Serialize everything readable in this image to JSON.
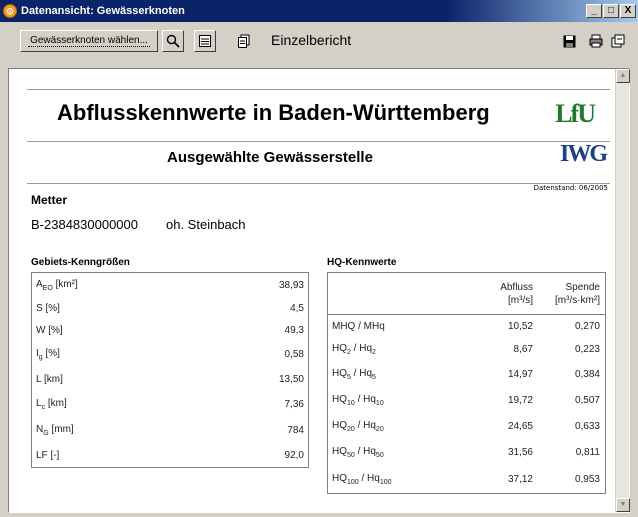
{
  "window": {
    "title": "Datenansicht: Gewässerknoten",
    "minimize": "_",
    "maximize": "□",
    "close": "X"
  },
  "toolbar": {
    "select_label": "Gewässerknoten wählen...",
    "report_label": "Einzelbericht"
  },
  "report": {
    "title": "Abflusskennwerte in Baden-Württemberg",
    "subtitle": "Ausgewählte Gewässerstelle",
    "logo1": "LfU",
    "logo2": "IWG",
    "datenstand": "Datenstand: 06/2005",
    "station_name": "Metter",
    "station_id": "B-2384830000000",
    "station_desc": "oh. Steinbach",
    "gebiet_label": "Gebiets-Kenngrößen",
    "hq_label": "HQ-Kennwerte",
    "gebiet_rows": [
      {
        "label": "A",
        "sub": "EO",
        "unit": " [km²]",
        "value": "38,93"
      },
      {
        "label": "S [%]",
        "sub": "",
        "unit": "",
        "value": "4,5"
      },
      {
        "label": "W [%]",
        "sub": "",
        "unit": "",
        "value": "49,3"
      },
      {
        "label": "I",
        "sub": "g",
        "unit": " [%]",
        "value": "0,58"
      },
      {
        "label": "L [km]",
        "sub": "",
        "unit": "",
        "value": "13,50"
      },
      {
        "label": "L",
        "sub": "c",
        "unit": " [km]",
        "value": "7,36"
      },
      {
        "label": "N",
        "sub": "G",
        "unit": " [mm]",
        "value": "784"
      },
      {
        "label": "LF [-]",
        "sub": "",
        "unit": "",
        "value": "92,0"
      }
    ],
    "hq_header": {
      "abfluss": "Abfluss",
      "abfluss_unit": "[m³/s]",
      "spende": "Spende",
      "spende_unit": "[m³/s·km²]"
    },
    "hq_rows": [
      {
        "a": "MHQ / MHq",
        "a_sub": "",
        "b": "",
        "b_sub": "",
        "abfluss": "10,52",
        "spende": "0,270"
      },
      {
        "a": "HQ",
        "a_sub": "2",
        "b": " / Hq",
        "b_sub": "2",
        "abfluss": "8,67",
        "spende": "0,223"
      },
      {
        "a": "HQ",
        "a_sub": "5",
        "b": " / Hq",
        "b_sub": "5",
        "abfluss": "14,97",
        "spende": "0,384"
      },
      {
        "a": "HQ",
        "a_sub": "10",
        "b": " / Hq",
        "b_sub": "10",
        "abfluss": "19,72",
        "spende": "0,507"
      },
      {
        "a": "HQ",
        "a_sub": "20",
        "b": " / Hq",
        "b_sub": "20",
        "abfluss": "24,65",
        "spende": "0,633"
      },
      {
        "a": "HQ",
        "a_sub": "50",
        "b": " / Hq",
        "b_sub": "50",
        "abfluss": "31,56",
        "spende": "0,811"
      },
      {
        "a": "HQ",
        "a_sub": "100",
        "b": " / Hq",
        "b_sub": "100",
        "abfluss": "37,12",
        "spende": "0,953"
      }
    ]
  }
}
